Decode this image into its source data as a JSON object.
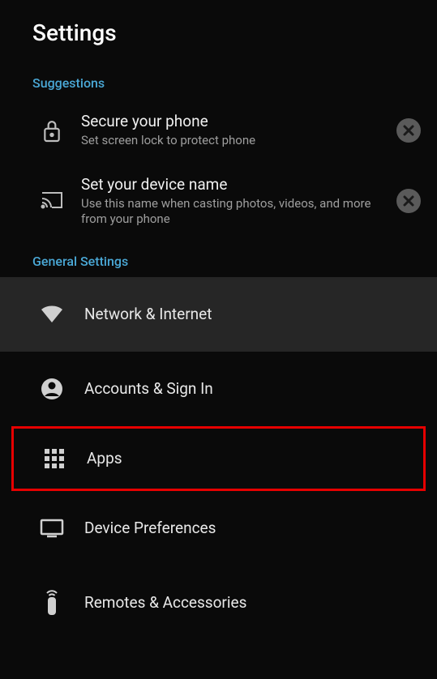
{
  "header": {
    "title": "Settings"
  },
  "suggestions": {
    "label": "Suggestions",
    "items": [
      {
        "title": "Secure your phone",
        "sub": "Set screen lock to protect phone"
      },
      {
        "title": "Set your device name",
        "sub": "Use this name when casting photos, videos, and more from your phone"
      }
    ]
  },
  "general": {
    "label": "General Settings",
    "items": {
      "network": "Network & Internet",
      "accounts": "Accounts & Sign In",
      "apps": "Apps",
      "device": "Device Preferences",
      "remotes": "Remotes & Accessories"
    }
  }
}
